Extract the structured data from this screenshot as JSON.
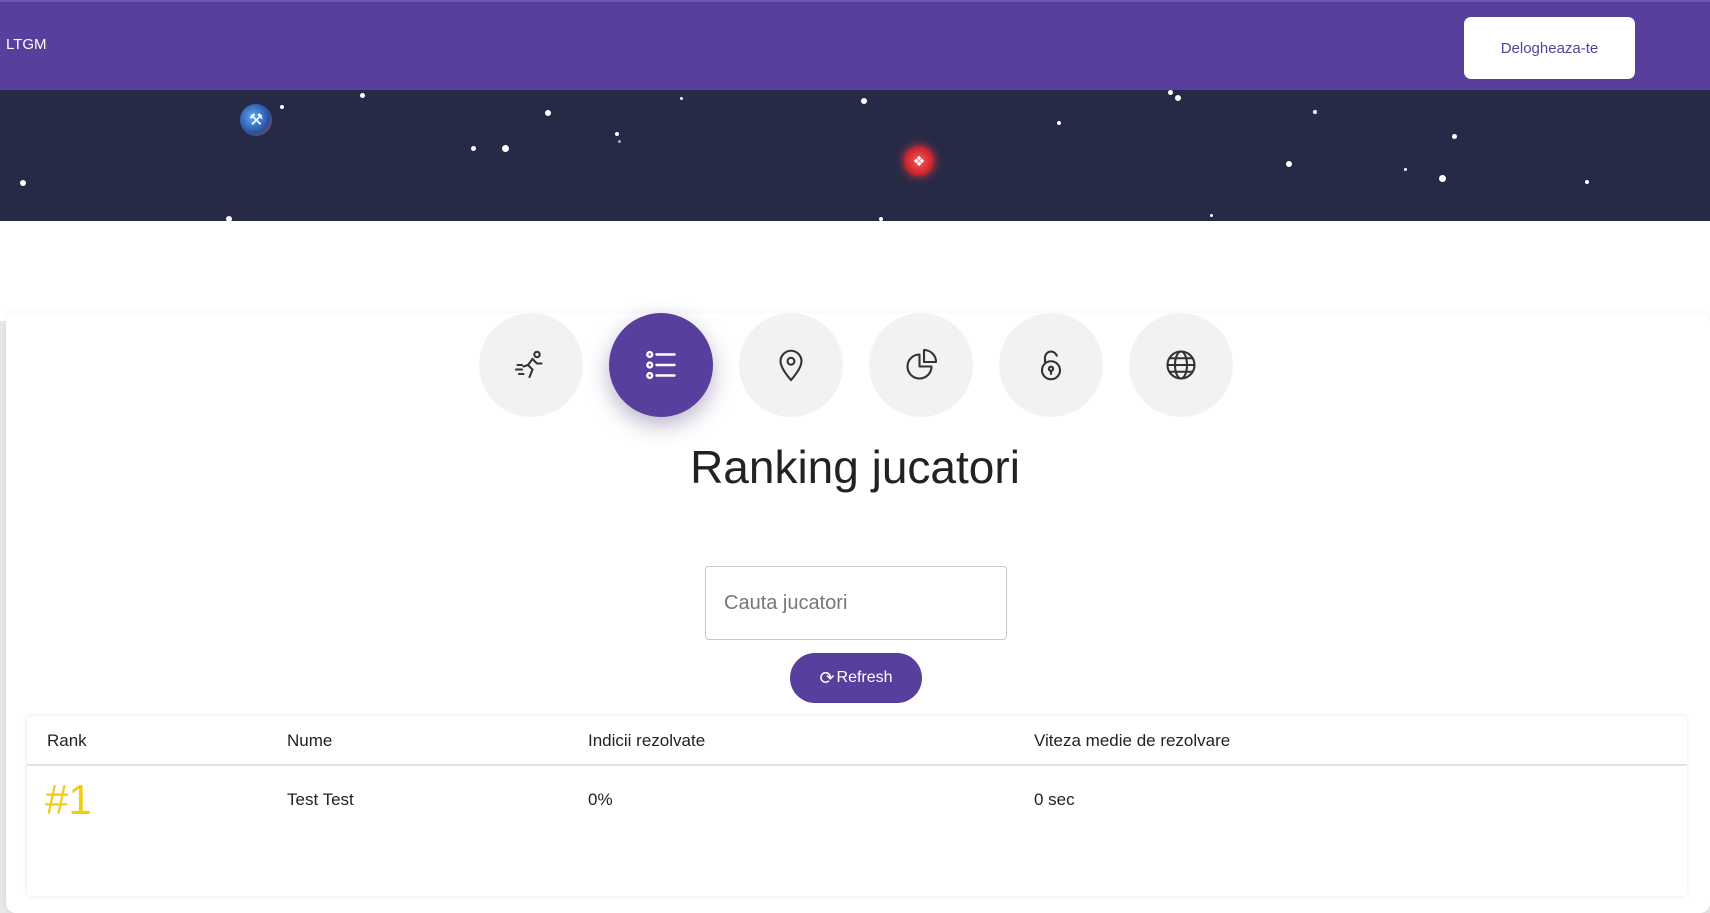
{
  "header": {
    "brand": "LTGM",
    "logout_label": "Delogheaza-te",
    "color": "#583f9d"
  },
  "nav": {
    "items": [
      {
        "name": "runner-icon",
        "active": false
      },
      {
        "name": "list-icon",
        "active": true
      },
      {
        "name": "location-pin-icon",
        "active": false
      },
      {
        "name": "pie-chart-icon",
        "active": false
      },
      {
        "name": "unlock-icon",
        "active": false
      },
      {
        "name": "globe-icon",
        "active": false
      }
    ]
  },
  "main": {
    "title": "Ranking jucatori",
    "search_placeholder": "Cauta jucatori",
    "refresh_label": "Refresh",
    "refresh_icon": "refresh-icon"
  },
  "table": {
    "headers": [
      "Rank",
      "Nume",
      "Indicii rezolvate",
      "Viteza medie de rezolvare"
    ],
    "rows": [
      {
        "rank": "#1",
        "name": "Test Test",
        "solved": "0%",
        "speed": "0 sec"
      }
    ],
    "rank_color": "#f2cc0f"
  }
}
